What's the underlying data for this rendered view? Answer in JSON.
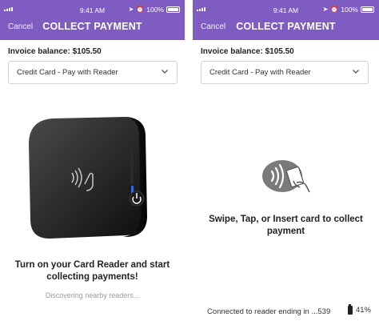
{
  "status_bar": {
    "time": "9:41 AM",
    "battery_percent": "100%"
  },
  "screen1": {
    "cancel": "Cancel",
    "title": "COLLECT PAYMENT",
    "balance": "Invoice balance: $105.50",
    "payment_method": "Credit Card - Pay with Reader",
    "headline": "Turn on your Card Reader and start collecting payments!",
    "discovering": "Discovering nearby readers..."
  },
  "screen2": {
    "cancel": "Cancel",
    "title": "COLLECT PAYMENT",
    "balance": "Invoice balance: $105.50",
    "payment_method": "Credit Card - Pay with Reader",
    "instruction": "Swipe, Tap, or Insert card to collect payment",
    "connected": "Connected to reader ending in ...539",
    "reader_battery": "41%"
  },
  "colors": {
    "header": "#7e5cc2",
    "reader_light": "#2f6fe0"
  },
  "icons": [
    "signal-icon",
    "location-icon",
    "alarm-icon",
    "battery-icon",
    "chevron-down-icon",
    "card-reader-image",
    "contactless-tap-icon",
    "reader-battery-icon"
  ]
}
